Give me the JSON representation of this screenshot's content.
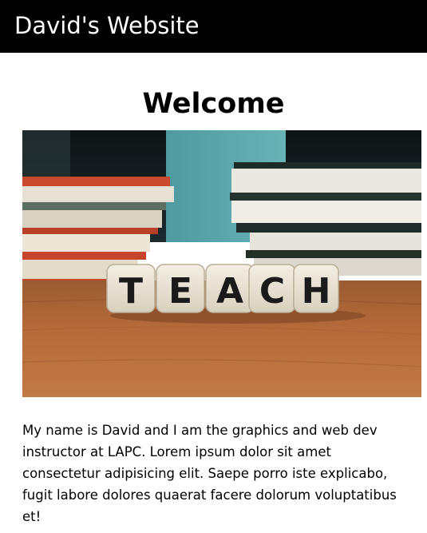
{
  "header": {
    "site_title": "David's Website"
  },
  "main": {
    "heading": "Welcome",
    "hero_image": {
      "subject": "letter dice spelling a word on a wooden desk with stacks of books",
      "dice_letters": [
        "T",
        "E",
        "A",
        "C",
        "H"
      ]
    },
    "intro_text": "My name is David and I am the graphics and web dev instructor at LAPC. Lorem ipsum dolor sit amet consectetur adipisicing elit. Saepe porro iste explicabo, fugit labore dolores quaerat facere dolorum voluptatibus et!"
  },
  "colors": {
    "header_bg": "#000000",
    "header_text": "#ffffff",
    "page_bg": "#ffffff",
    "body_text": "#000000"
  }
}
